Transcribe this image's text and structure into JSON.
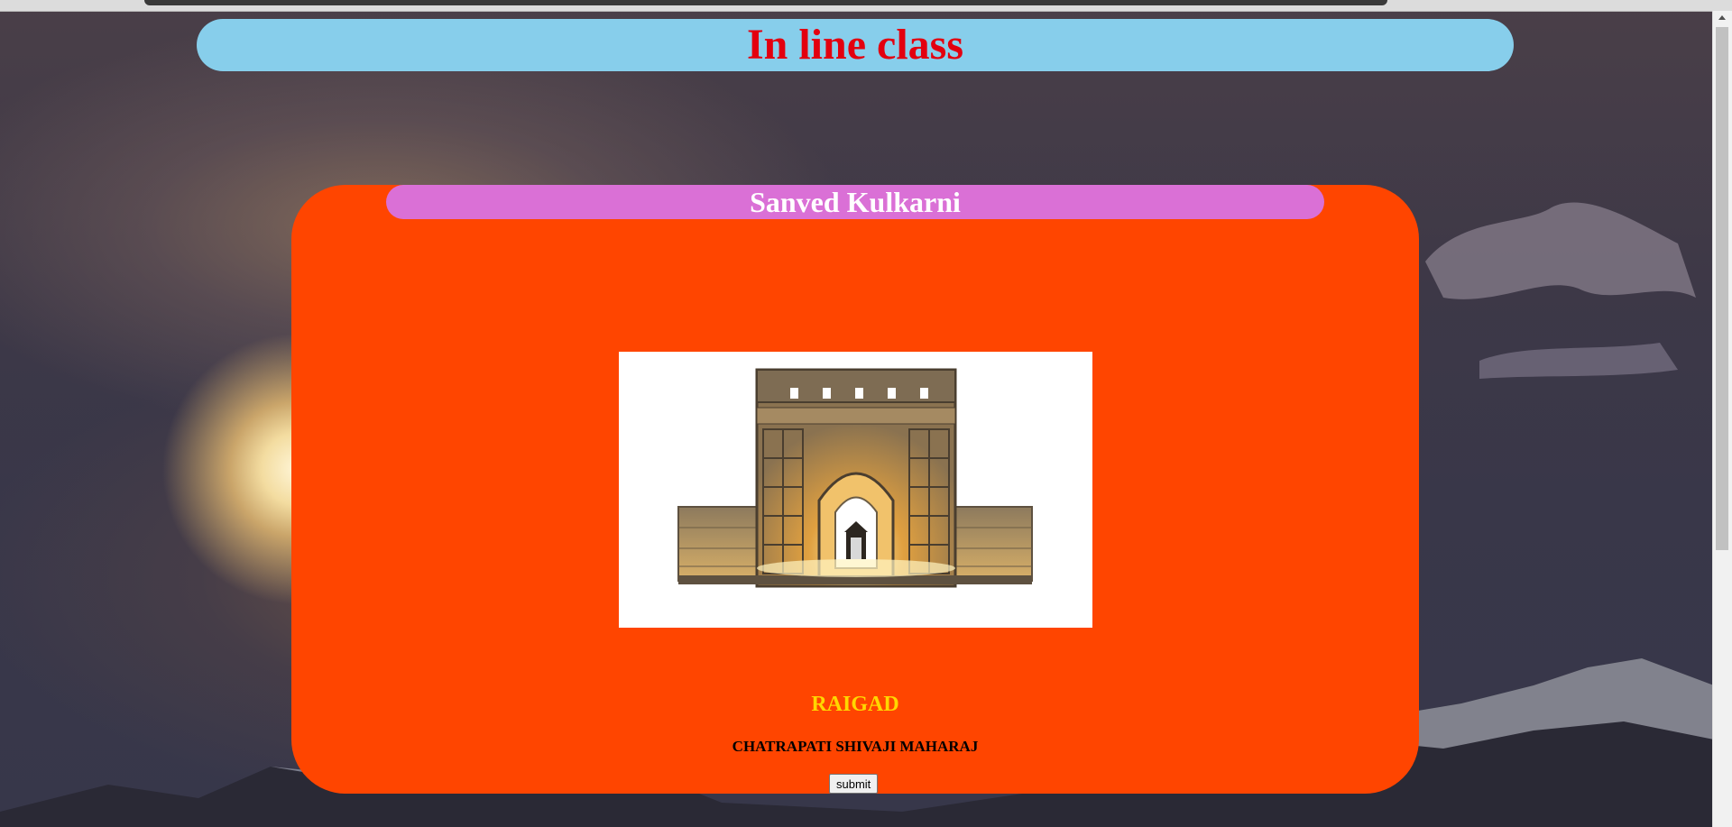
{
  "page": {
    "header_title": "In line class",
    "name_banner": "Sanved Kulkarni",
    "place_title": "RAIGAD",
    "person_title": "CHATRAPATI SHIVAJI MAHARAJ",
    "submit_label": "submit"
  },
  "colors": {
    "header_bg": "#87ceeb",
    "header_text": "#e3000f",
    "card_bg": "#ff4500",
    "name_bar_bg": "#da70d6",
    "place_text": "#ffd700"
  },
  "image": {
    "subject": "illuminated fort gate model"
  }
}
